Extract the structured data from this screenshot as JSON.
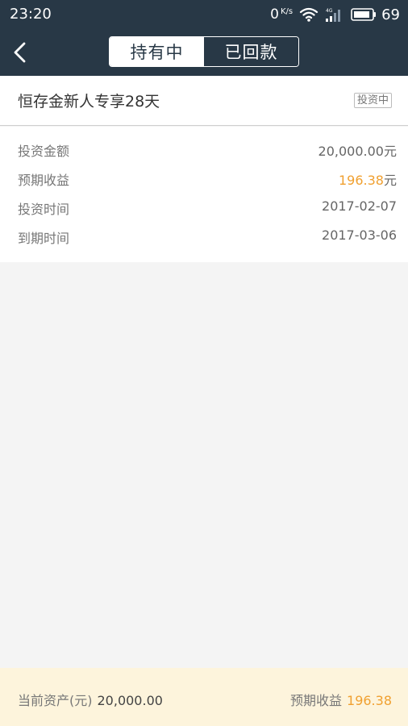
{
  "status_bar": {
    "time": "23:20",
    "net_speed": "0",
    "net_speed_unit": "K/s",
    "battery_level": "69",
    "icons": [
      "wifi-icon",
      "signal-4g-icon",
      "battery-icon"
    ]
  },
  "nav": {
    "back_icon": "chevron-left-icon",
    "tabs": [
      {
        "label": "持有中",
        "active": true
      },
      {
        "label": "已回款",
        "active": false
      }
    ]
  },
  "product": {
    "name": "恒存金新人专享28天",
    "status": "投资中"
  },
  "details": [
    {
      "label": "投资金额",
      "value": "20,000.00",
      "unit": "元"
    },
    {
      "label": "预期收益",
      "value": "196.38",
      "unit": "元"
    },
    {
      "label": "投资时间",
      "value": "2017-02-07",
      "unit": ""
    },
    {
      "label": "到期时间",
      "value": "2017-03-06",
      "unit": ""
    }
  ],
  "footer": {
    "assets_label": "当前资产(元)",
    "assets_value": "20,000.00",
    "earnings_label": "预期收益",
    "earnings_value": "196.38"
  },
  "colors": {
    "header_bg": "#283846",
    "highlight": "#f0a030",
    "footer_bg": "#fdf4dc",
    "page_bg": "#f4f4f4"
  }
}
